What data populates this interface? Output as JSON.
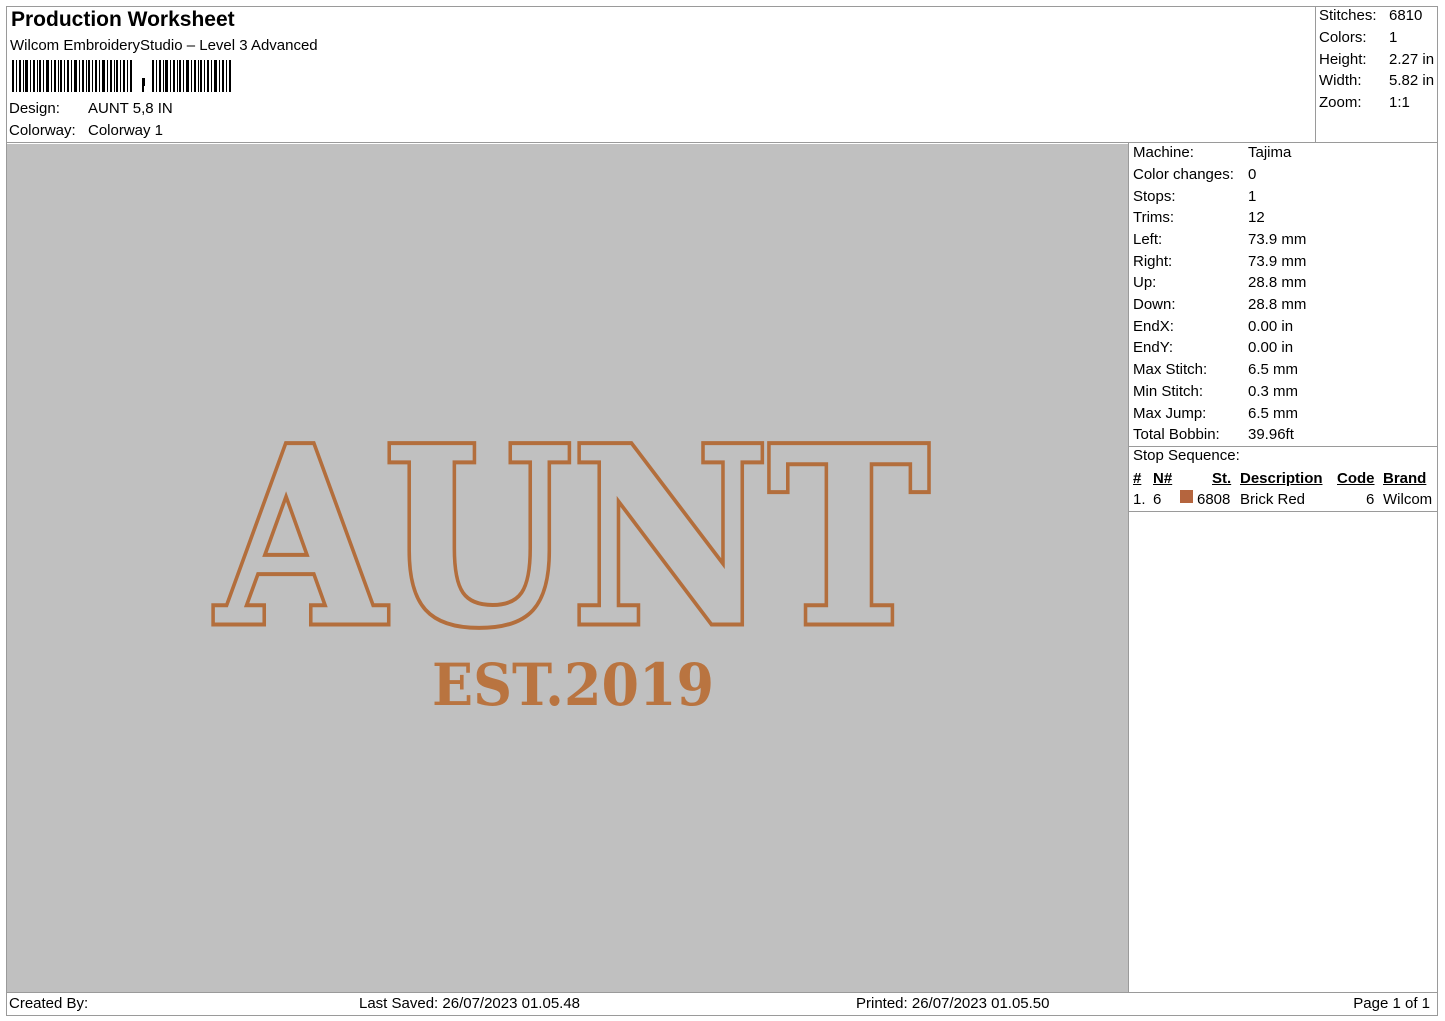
{
  "header": {
    "title": "Production Worksheet",
    "software": "Wilcom EmbroideryStudio – Level 3 Advanced",
    "barcode_glyph": ",",
    "design_label": "Design:",
    "design_value": "AUNT 5,8 IN",
    "colorway_label": "Colorway:",
    "colorway_value": "Colorway 1"
  },
  "summary": [
    {
      "label": "Stitches:",
      "value": "6810"
    },
    {
      "label": "Colors:",
      "value": "1"
    },
    {
      "label": "Height:",
      "value": "2.27 in"
    },
    {
      "label": "Width:",
      "value": "5.82 in"
    },
    {
      "label": "Zoom:",
      "value": "1:1"
    }
  ],
  "machine_info": [
    {
      "label": "Machine:",
      "value": "Tajima"
    },
    {
      "label": "Color changes:",
      "value": "0"
    },
    {
      "label": "Stops:",
      "value": "1"
    },
    {
      "label": "Trims:",
      "value": "12"
    },
    {
      "label": "Left:",
      "value": "73.9 mm"
    },
    {
      "label": "Right:",
      "value": "73.9 mm"
    },
    {
      "label": "Up:",
      "value": "28.8 mm"
    },
    {
      "label": "Down:",
      "value": "28.8 mm"
    },
    {
      "label": "EndX:",
      "value": "0.00 in"
    },
    {
      "label": "EndY:",
      "value": "0.00 in"
    },
    {
      "label": "Max Stitch:",
      "value": "6.5 mm"
    },
    {
      "label": "Min Stitch:",
      "value": "0.3 mm"
    },
    {
      "label": "Max Jump:",
      "value": "6.5 mm"
    },
    {
      "label": "Total Bobbin:",
      "value": "39.96ft"
    }
  ],
  "stop_sequence": {
    "title": "Stop Sequence:",
    "columns": {
      "hash": "#",
      "n": "N#",
      "st": "St.",
      "description": "Description",
      "code": "Code",
      "brand": "Brand"
    },
    "rows": [
      {
        "index": "1.",
        "n": "6",
        "st": "6808",
        "description": "Brick Red",
        "code": "6",
        "brand": "Wilcom",
        "color": "#b5653e"
      }
    ]
  },
  "design": {
    "main_text": "AUNT",
    "sub_text": "EST.2019",
    "thread_color": "#c07b45",
    "background_color": "#c0c0c0"
  },
  "footer": {
    "created_by": "Created By:",
    "last_saved": "Last Saved: 26/07/2023 01.05.48",
    "printed": "Printed: 26/07/2023 01.05.50",
    "page": "Page 1 of 1"
  }
}
